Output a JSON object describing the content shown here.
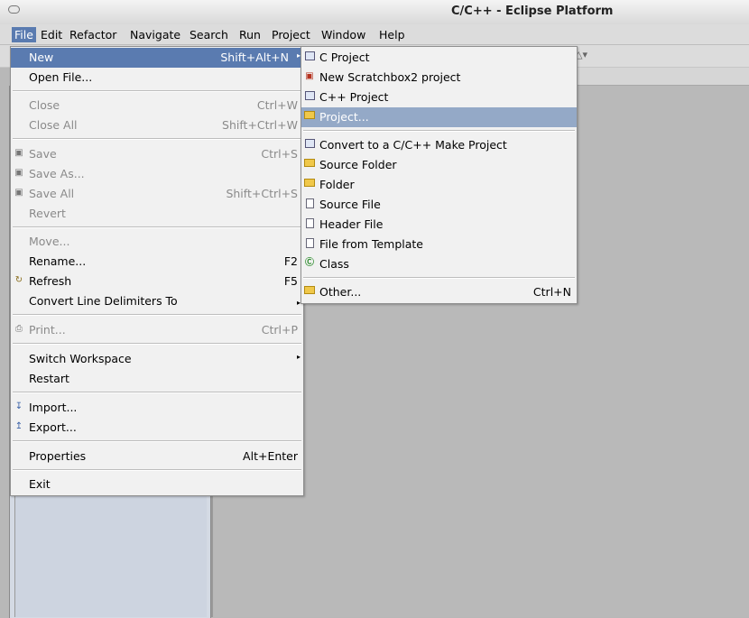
{
  "window": {
    "title": "C/C++ - Eclipse Platform"
  },
  "menubar": {
    "items": [
      "File",
      "Edit",
      "Refactor",
      "Navigate",
      "Search",
      "Run",
      "Project",
      "Window",
      "Help"
    ]
  },
  "file_menu": {
    "items": [
      {
        "label": "New",
        "accel": "Shift+Alt+N"
      },
      {
        "label": "Open File...",
        "accel": ""
      },
      {
        "label": "Close",
        "accel": "Ctrl+W"
      },
      {
        "label": "Close All",
        "accel": "Shift+Ctrl+W"
      },
      {
        "label": "Save",
        "accel": "Ctrl+S"
      },
      {
        "label": "Save As...",
        "accel": ""
      },
      {
        "label": "Save All",
        "accel": "Shift+Ctrl+S"
      },
      {
        "label": "Revert",
        "accel": ""
      },
      {
        "label": "Move...",
        "accel": ""
      },
      {
        "label": "Rename...",
        "accel": "F2"
      },
      {
        "label": "Refresh",
        "accel": "F5"
      },
      {
        "label": "Convert Line Delimiters To",
        "accel": ""
      },
      {
        "label": "Print...",
        "accel": "Ctrl+P"
      },
      {
        "label": "Switch Workspace",
        "accel": ""
      },
      {
        "label": "Restart",
        "accel": ""
      },
      {
        "label": "Import...",
        "accel": ""
      },
      {
        "label": "Export...",
        "accel": ""
      },
      {
        "label": "Properties",
        "accel": "Alt+Enter"
      },
      {
        "label": "Exit",
        "accel": ""
      }
    ]
  },
  "new_submenu": {
    "items": [
      {
        "label": "C Project",
        "accel": ""
      },
      {
        "label": "New Scratchbox2 project",
        "accel": ""
      },
      {
        "label": "C++ Project",
        "accel": ""
      },
      {
        "label": "Project...",
        "accel": ""
      },
      {
        "label": "Convert to a C/C++ Make Project",
        "accel": ""
      },
      {
        "label": "Source Folder",
        "accel": ""
      },
      {
        "label": "Folder",
        "accel": ""
      },
      {
        "label": "Source File",
        "accel": ""
      },
      {
        "label": "Header File",
        "accel": ""
      },
      {
        "label": "File from Template",
        "accel": ""
      },
      {
        "label": "Class",
        "accel": ""
      },
      {
        "label": "Other...",
        "accel": "Ctrl+N"
      }
    ]
  },
  "colors": {
    "menu_highlight": "#5a7bb0",
    "submenu_highlight": "#94a9c7"
  }
}
